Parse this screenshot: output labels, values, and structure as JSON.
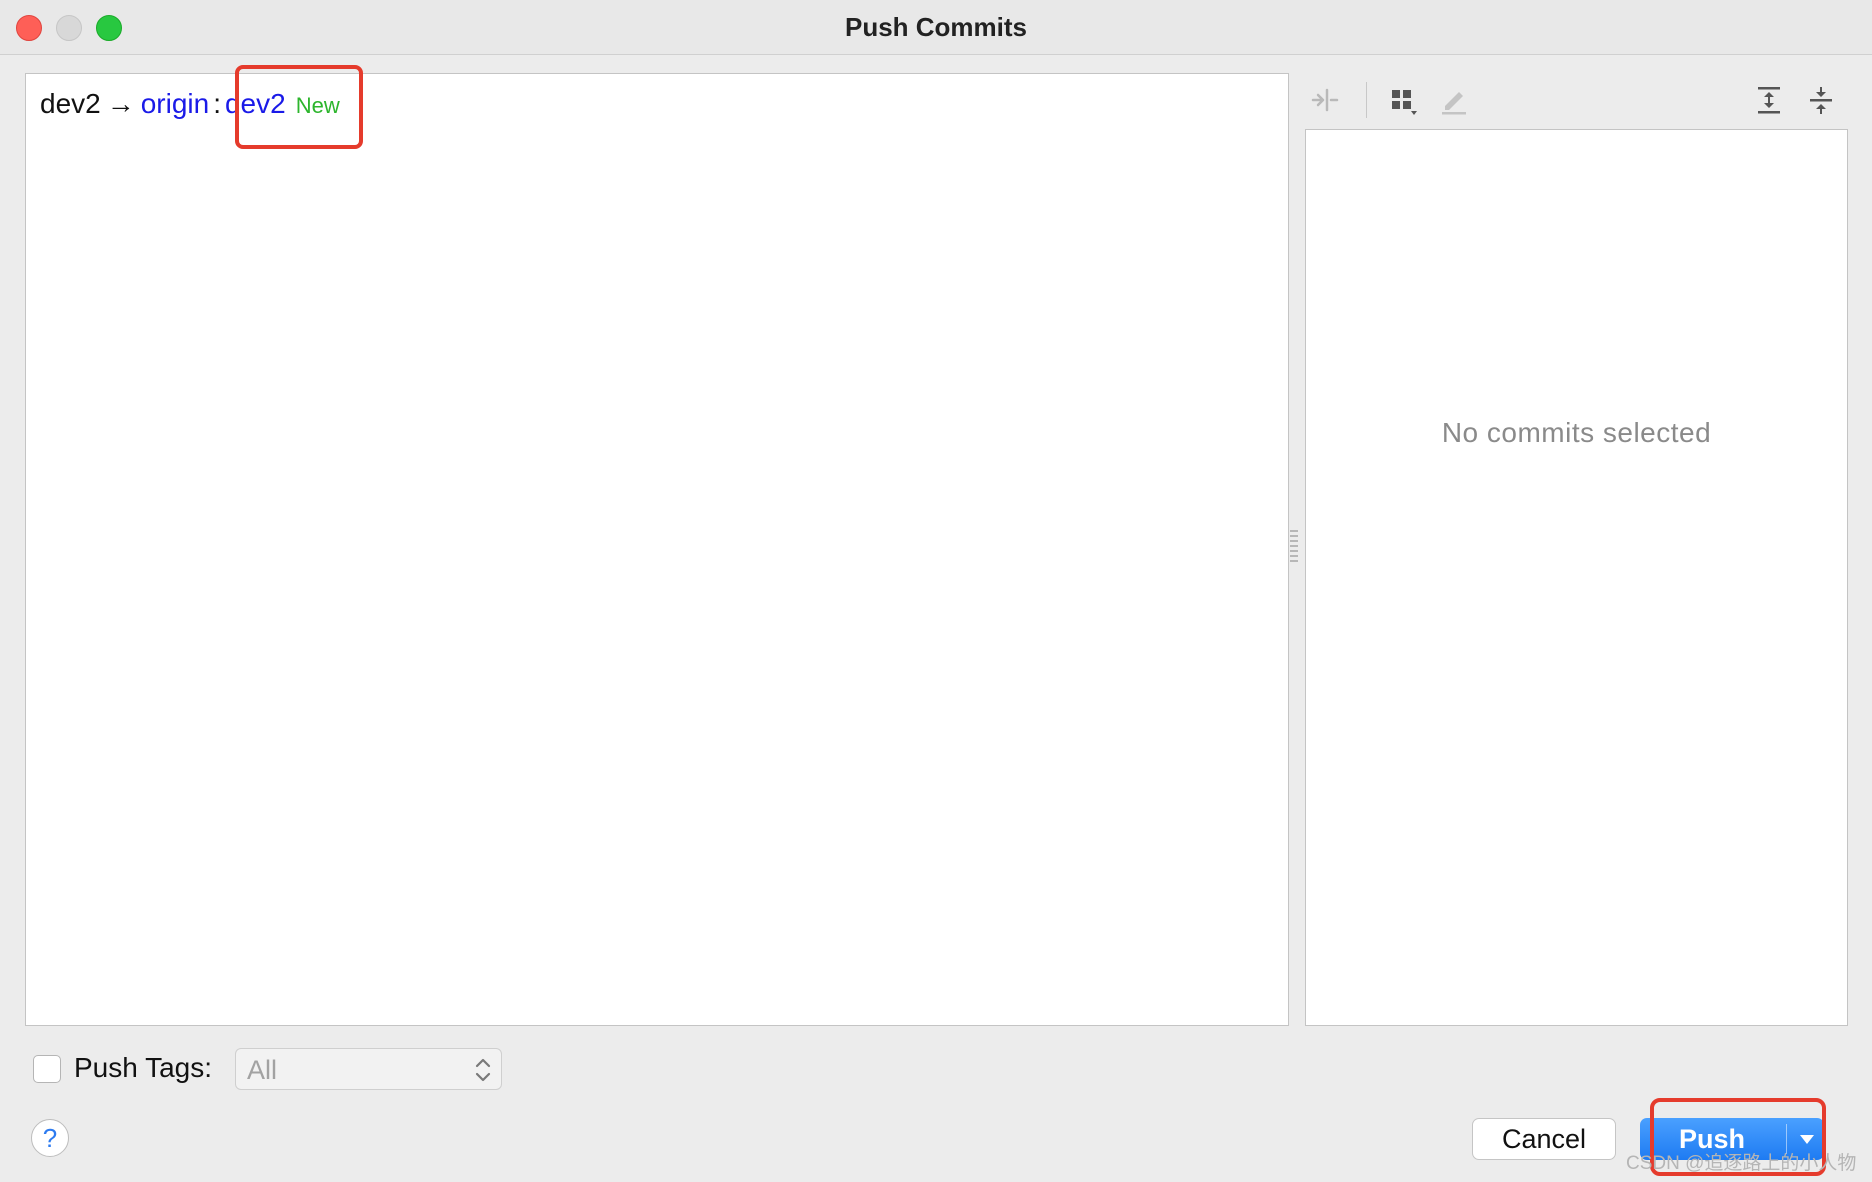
{
  "window": {
    "title": "Push Commits"
  },
  "push_spec": {
    "local_branch": "dev2",
    "arrow": "→",
    "remote": "origin",
    "separator": ":",
    "target_branch": "dev2",
    "new_badge": "New"
  },
  "details": {
    "empty_message": "No commits selected"
  },
  "toolbar": {
    "icons": [
      "merge-arrows-icon",
      "grid-icon",
      "edit-pencil-icon",
      "expand-all-icon",
      "collapse-all-icon"
    ]
  },
  "footer": {
    "push_tags_label": "Push Tags:",
    "push_tags_checked": false,
    "push_tags_select_value": "All",
    "help_label": "?",
    "cancel_label": "Cancel",
    "push_label": "Push"
  },
  "watermark": "CSDN @追逐路上的小人物",
  "colors": {
    "highlight": "#e53b2c",
    "link_blue": "#1a1ae8",
    "new_green": "#2db52d",
    "primary_button": "#1e7bf2"
  }
}
